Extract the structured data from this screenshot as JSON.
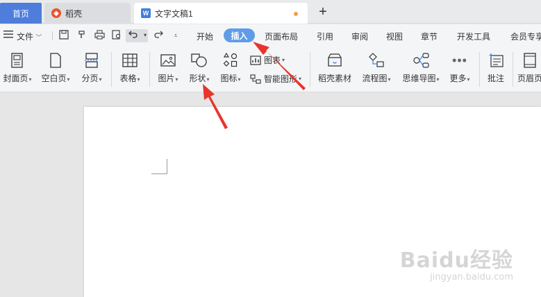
{
  "tabs": {
    "home": "首页",
    "daoke": "稻壳",
    "doc": "文字文稿1",
    "new_tab": "+"
  },
  "menu": {
    "file": "文件",
    "items": [
      "开始",
      "插入",
      "页面布局",
      "引用",
      "审阅",
      "视图",
      "章节",
      "开发工具",
      "会员专享"
    ],
    "active": "插入"
  },
  "ribbon": {
    "cover": "封面页",
    "blank": "空白页",
    "section": "分页",
    "table": "表格",
    "picture": "图片",
    "shape": "形状",
    "icons": "图标",
    "chart": "图表",
    "smartart": "智能图形",
    "daoke_material": "稻壳素材",
    "flowchart": "流程图",
    "mindmap": "思维导图",
    "more": "更多",
    "comment": "批注",
    "header_footer": "页眉页"
  },
  "watermark": {
    "brand": "Baidu经验",
    "url": "jingyan.baidu.com"
  },
  "colors": {
    "accent": "#4e7ddb",
    "active_pill": "#5f9ce8",
    "arrow": "#e8342c"
  }
}
